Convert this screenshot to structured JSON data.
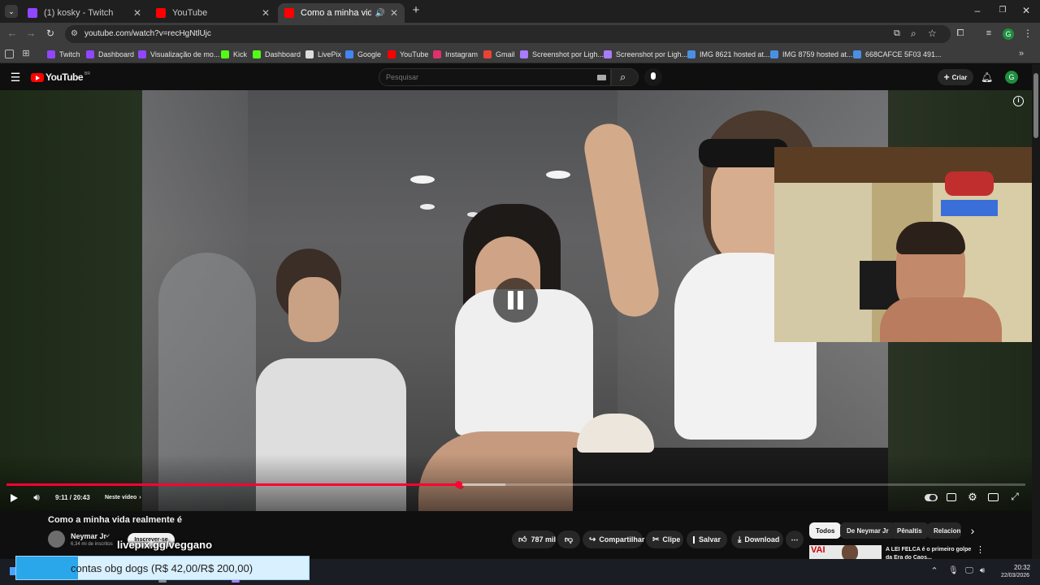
{
  "browser": {
    "tabs": [
      {
        "title": "(1) kosky - Twitch",
        "color": "#9146ff"
      },
      {
        "title": "YouTube",
        "color": "#ff0000"
      },
      {
        "title": "Como a minha vida realme",
        "color": "#ff0000"
      }
    ],
    "url": "youtube.com/watch?v=recHgNtlUjc",
    "bookmarks": [
      {
        "label": "Twitch",
        "color": "#9146ff"
      },
      {
        "label": "Dashboard",
        "color": "#9146ff"
      },
      {
        "label": "Visualização de mo...",
        "color": "#9146ff"
      },
      {
        "label": "Kick",
        "color": "#53fc18"
      },
      {
        "label": "Dashboard",
        "color": "#53fc18"
      },
      {
        "label": "LivePix",
        "color": "#dddddd"
      },
      {
        "label": "Google",
        "color": "#4285f4"
      },
      {
        "label": "YouTube",
        "color": "#ff0000"
      },
      {
        "label": "Instagram",
        "color": "#e1306c"
      },
      {
        "label": "Gmail",
        "color": "#ea4335"
      },
      {
        "label": "Screenshot por Ligh...",
        "color": "#a97bff"
      },
      {
        "label": "Screenshot por Ligh...",
        "color": "#a97bff"
      },
      {
        "label": "IMG 8621 hosted at...",
        "color": "#4a90e2"
      },
      {
        "label": "IMG 8759 hosted at...",
        "color": "#4a90e2"
      },
      {
        "label": "668CAFCE 5F03 491...",
        "color": "#4a90e2"
      }
    ],
    "profile_initial": "G"
  },
  "youtube": {
    "logo_text": "YouTube",
    "logo_badge": "BR",
    "search_placeholder": "Pesquisar",
    "create_label": "Criar",
    "profile_initial": "G"
  },
  "player": {
    "time": "9:11 / 20:43",
    "chapter": "Neste vídeo",
    "progress": 0.443,
    "buffered": 0.49
  },
  "video_info": {
    "title": "Como a minha vida realmente é",
    "channel": "Neymar Jr",
    "subscribers": "6,34 mi de inscritos",
    "subscribe_label": "Inscrever-se",
    "likes": "787 mil",
    "share_label": "Compartilhar",
    "clip_label": "Clipe",
    "save_label": "Salvar",
    "download_label": "Download"
  },
  "chips": [
    "Todos",
    "De Neymar Jr",
    "Pênaltis",
    "Relacion"
  ],
  "recommendation": {
    "thumb_text": "VAI",
    "title": "A LEI FELCA é o primeiro golpe",
    "subtitle": "da Era do Caos..."
  },
  "overlay": {
    "stream_tag": "livepix.gg/veggano",
    "donation_text": "contas obg dogs (R$ 42,00/R$ 200,00)",
    "donation_progress": 0.21
  },
  "taskbar": {
    "time": "20:32",
    "date": "22/03/2026"
  }
}
